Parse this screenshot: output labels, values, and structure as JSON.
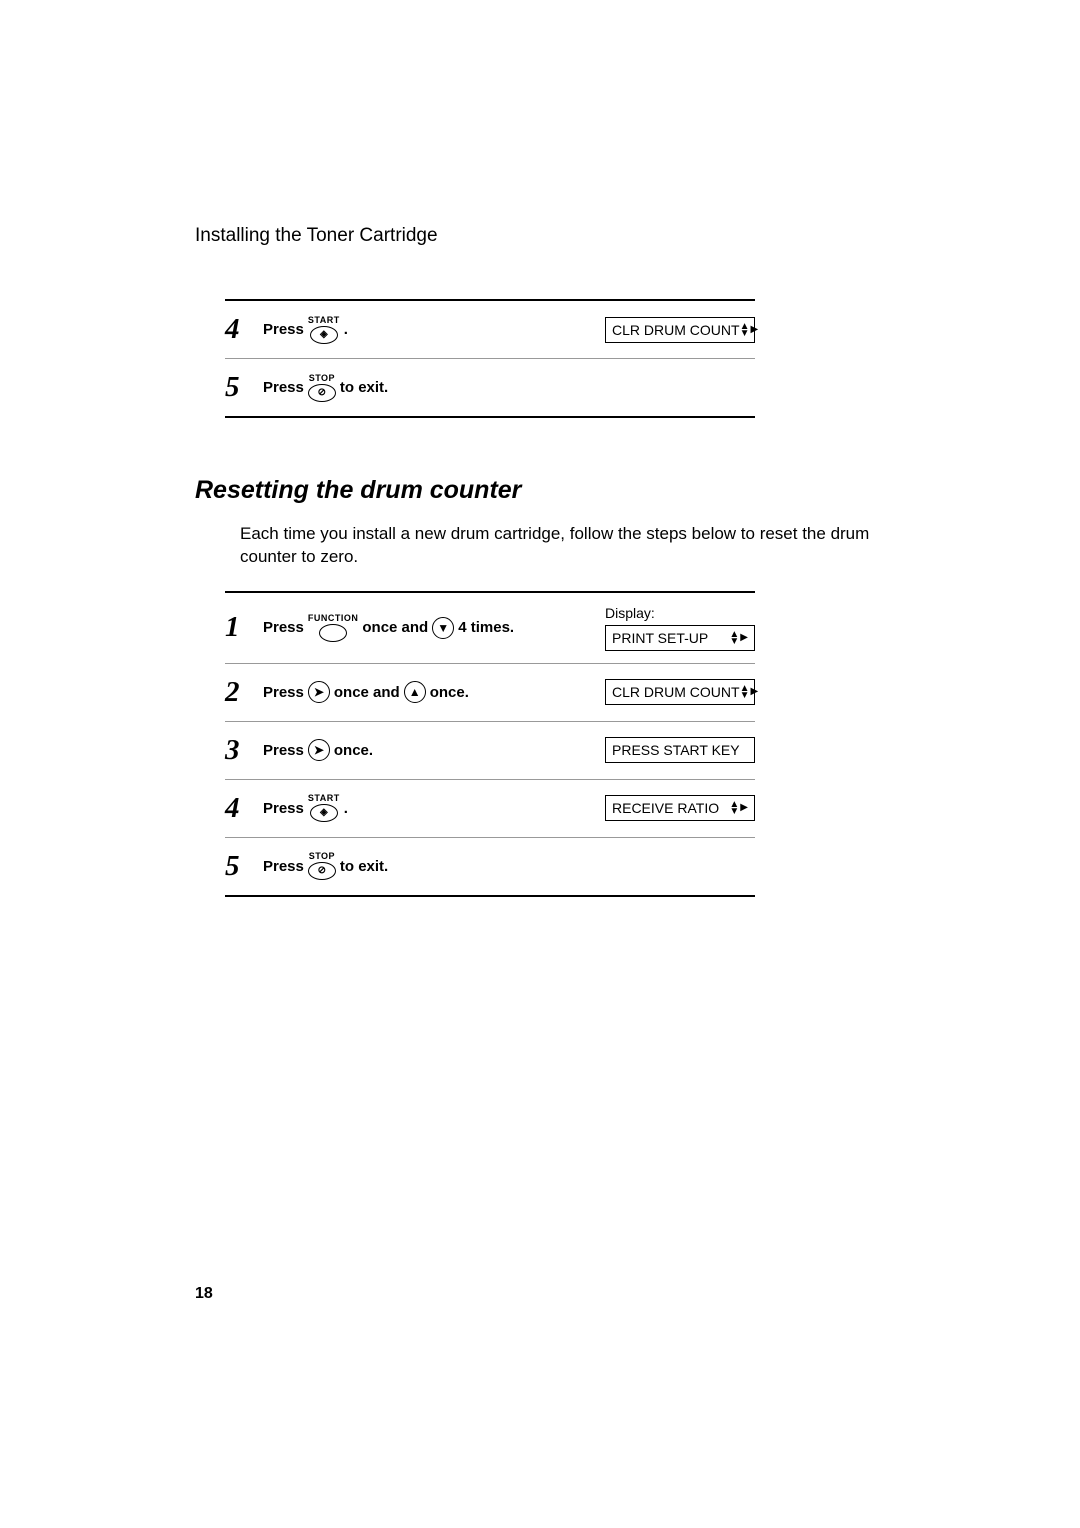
{
  "header": "Installing the Toner Cartridge",
  "page_number": "18",
  "top_steps": [
    {
      "num": "4",
      "press": "Press",
      "btn_label": "START",
      "btn_glyph": "◈",
      "after": ".",
      "display": "CLR DRUM COUNT",
      "has_arrows": true
    },
    {
      "num": "5",
      "press": "Press",
      "btn_label": "STOP",
      "btn_glyph": "⊘",
      "after": "to exit.",
      "display": null
    }
  ],
  "section": {
    "title": "Resetting the drum counter",
    "intro": "Each time you install a new drum cartridge, follow the steps below to reset the drum counter to zero.",
    "display_label": "Display:",
    "steps": [
      {
        "num": "1",
        "parts": [
          {
            "type": "text",
            "val": "Press"
          },
          {
            "type": "oval",
            "label": "FUNCTION",
            "glyph": ""
          },
          {
            "type": "text",
            "val": "once and"
          },
          {
            "type": "circle",
            "glyph": "▼"
          },
          {
            "type": "text",
            "val": "4 times."
          }
        ],
        "display": "PRINT SET-UP",
        "has_arrows": true,
        "show_display_label": true
      },
      {
        "num": "2",
        "parts": [
          {
            "type": "text",
            "val": "Press"
          },
          {
            "type": "circle",
            "glyph": "➤"
          },
          {
            "type": "text",
            "val": "once and"
          },
          {
            "type": "circle",
            "glyph": "▲"
          },
          {
            "type": "text",
            "val": "once."
          }
        ],
        "display": "CLR DRUM COUNT",
        "has_arrows": true
      },
      {
        "num": "3",
        "parts": [
          {
            "type": "text",
            "val": "Press"
          },
          {
            "type": "circle",
            "glyph": "➤"
          },
          {
            "type": "text",
            "val": "once."
          }
        ],
        "display": "PRESS START KEY",
        "has_arrows": false
      },
      {
        "num": "4",
        "parts": [
          {
            "type": "text",
            "val": "Press"
          },
          {
            "type": "oval",
            "label": "START",
            "glyph": "◈"
          },
          {
            "type": "text",
            "val": "."
          }
        ],
        "display": "RECEIVE RATIO",
        "has_arrows": true
      },
      {
        "num": "5",
        "parts": [
          {
            "type": "text",
            "val": "Press"
          },
          {
            "type": "oval",
            "label": "STOP",
            "glyph": "⊘"
          },
          {
            "type": "text",
            "val": "to exit."
          }
        ],
        "display": null
      }
    ]
  }
}
